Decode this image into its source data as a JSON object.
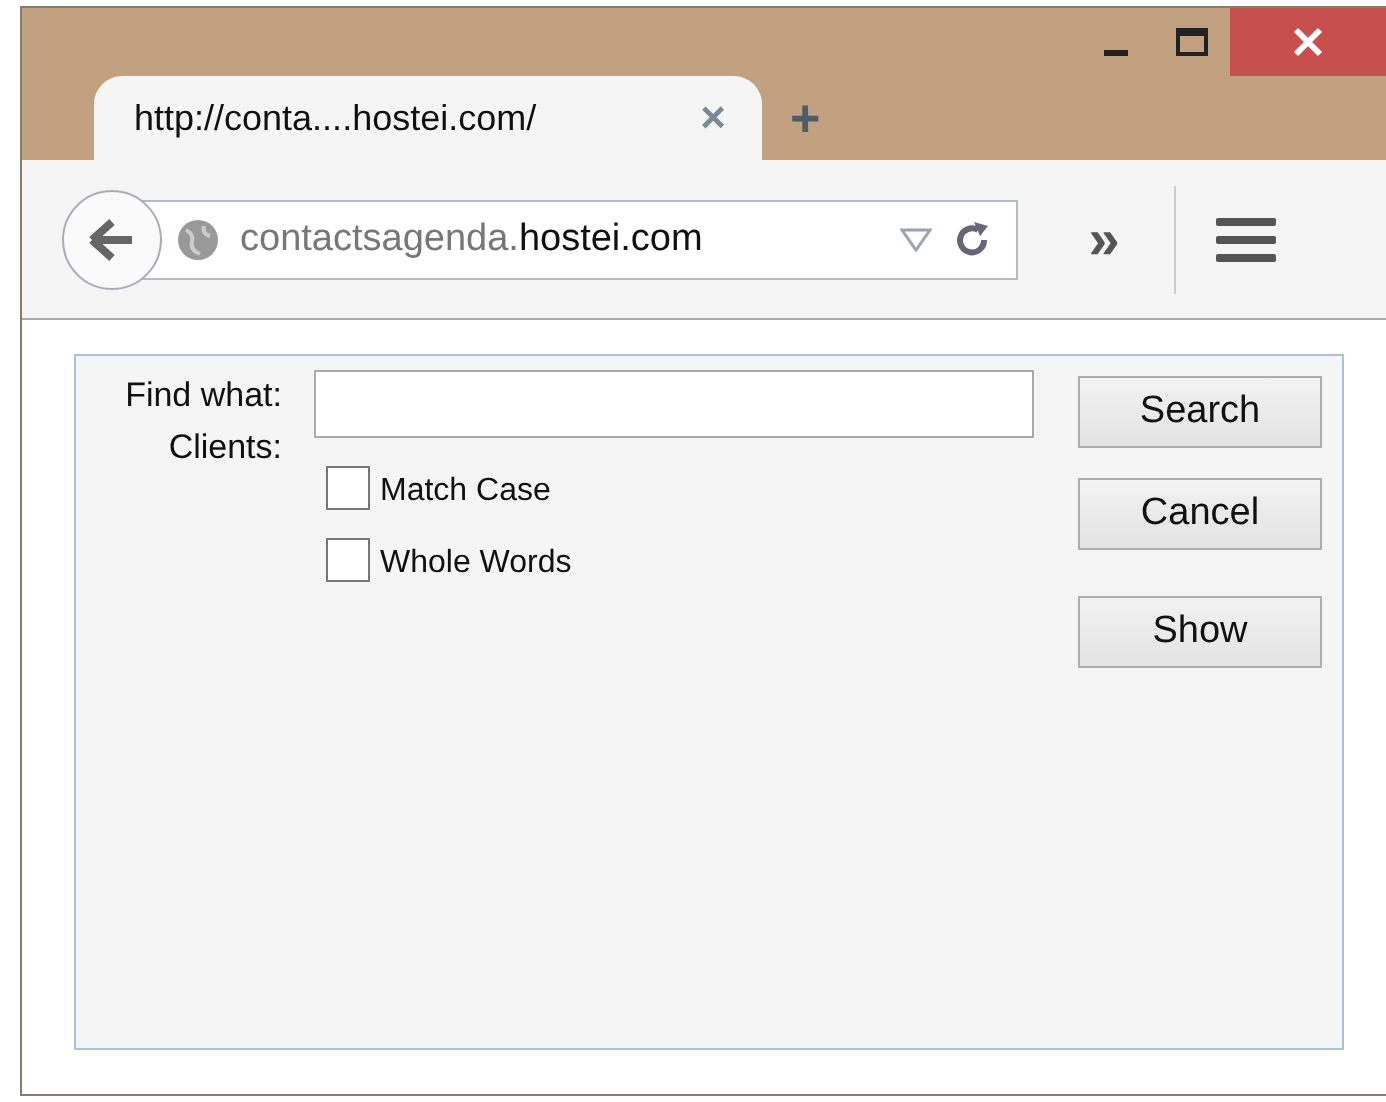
{
  "tab": {
    "title": "http://conta....hostei.com/",
    "close": "×",
    "new_tab": "+"
  },
  "address_bar": {
    "domain_prefix": "contactsagenda.",
    "domain": "hostei.com"
  },
  "toolbar": {
    "overflow": "»"
  },
  "dialog": {
    "labels": [
      "Find what:",
      "Clients:"
    ],
    "checkboxes": [
      {
        "label": "Match Case",
        "checked": false
      },
      {
        "label": "Whole Words",
        "checked": false
      }
    ],
    "buttons": [
      "Search",
      "Cancel",
      "Show"
    ]
  }
}
